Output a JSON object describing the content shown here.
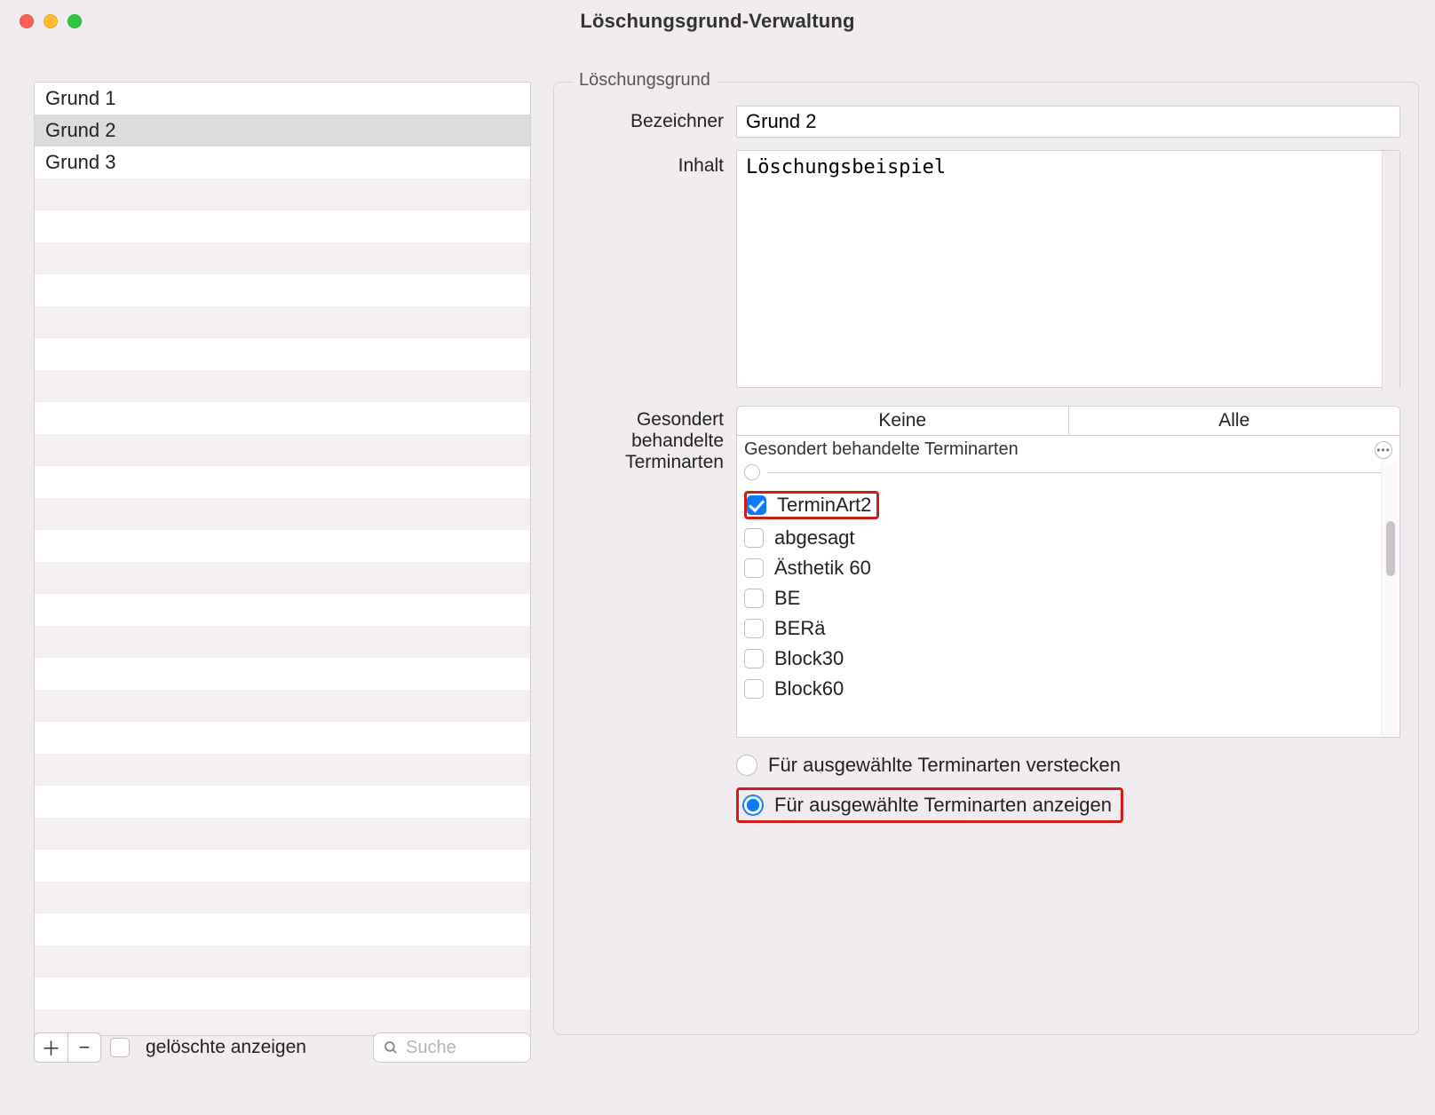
{
  "window": {
    "title": "Löschungsgrund-Verwaltung"
  },
  "list": {
    "items": [
      "Grund 1",
      "Grund 2",
      "Grund 3"
    ],
    "selected_index": 1,
    "row_count": 30,
    "show_deleted_label": "gelöschte anzeigen",
    "search_placeholder": "Suche"
  },
  "form": {
    "legend": "Löschungsgrund",
    "labels": {
      "identifier": "Bezeichner",
      "content": "Inhalt",
      "types_l1": "Gesondert",
      "types_l2": "behandelte",
      "types_l3": "Terminarten"
    },
    "identifier_value": "Grund 2",
    "content_value": "Löschungsbeispiel",
    "segment": {
      "none": "Keine",
      "all": "Alle"
    },
    "types_header": "Gesondert behandelte Terminarten",
    "types": [
      {
        "label": "TerminArt2",
        "checked": true,
        "highlight": true
      },
      {
        "label": "abgesagt",
        "checked": false,
        "highlight": false
      },
      {
        "label": "Ästhetik 60",
        "checked": false,
        "highlight": false
      },
      {
        "label": "BE",
        "checked": false,
        "highlight": false
      },
      {
        "label": "BERä",
        "checked": false,
        "highlight": false
      },
      {
        "label": "Block30",
        "checked": false,
        "highlight": false
      },
      {
        "label": "Block60",
        "checked": false,
        "highlight": false
      }
    ],
    "radio": {
      "hide_label": "Für ausgewählte Terminarten verstecken",
      "show_label": "Für ausgewählte Terminarten anzeigen",
      "selected": "show"
    }
  }
}
